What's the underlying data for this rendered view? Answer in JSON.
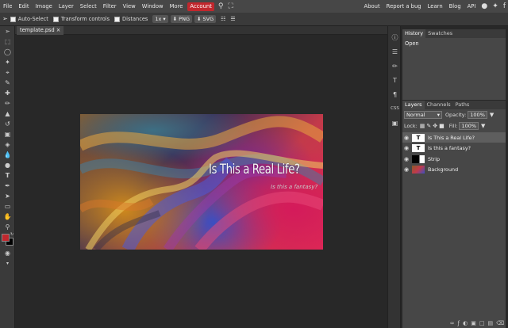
{
  "menubar": {
    "items": [
      "File",
      "Edit",
      "Image",
      "Layer",
      "Select",
      "Filter",
      "View",
      "Window",
      "More"
    ],
    "account": "Account",
    "right_items": [
      "About",
      "Report a bug",
      "Learn",
      "Blog",
      "API"
    ]
  },
  "options": {
    "auto_select": "Auto-Select",
    "transform_controls": "Transform controls",
    "distances": "Distances",
    "zoom": "1x",
    "png": "PNG",
    "svg": "SVG"
  },
  "document": {
    "tab": "template.psd",
    "title_text": "Is This a Real Life?",
    "subtitle_text": "Is this a fantasy?"
  },
  "history_panel": {
    "tabs": [
      "History",
      "Swatches"
    ],
    "items": [
      "Open"
    ]
  },
  "layers_panel": {
    "tabs": [
      "Layers",
      "Channels",
      "Paths"
    ],
    "blend_mode": "Normal",
    "opacity_label": "Opacity:",
    "opacity": "100%",
    "lock_label": "Lock:",
    "fill_label": "Fill:",
    "fill": "100%",
    "layers": [
      {
        "name": "Is This a Real Life?",
        "thumb": "T",
        "selected": true
      },
      {
        "name": "Is this a fantasy?",
        "thumb": "T",
        "selected": false
      },
      {
        "name": "Strip",
        "thumb": "",
        "selected": false
      },
      {
        "name": "Background",
        "thumb": "",
        "selected": false
      }
    ]
  },
  "side_icons": {
    "css": "CSS"
  },
  "colors": {
    "foreground": "#c1272d",
    "background": "#000000",
    "accent": "#c1272d"
  }
}
